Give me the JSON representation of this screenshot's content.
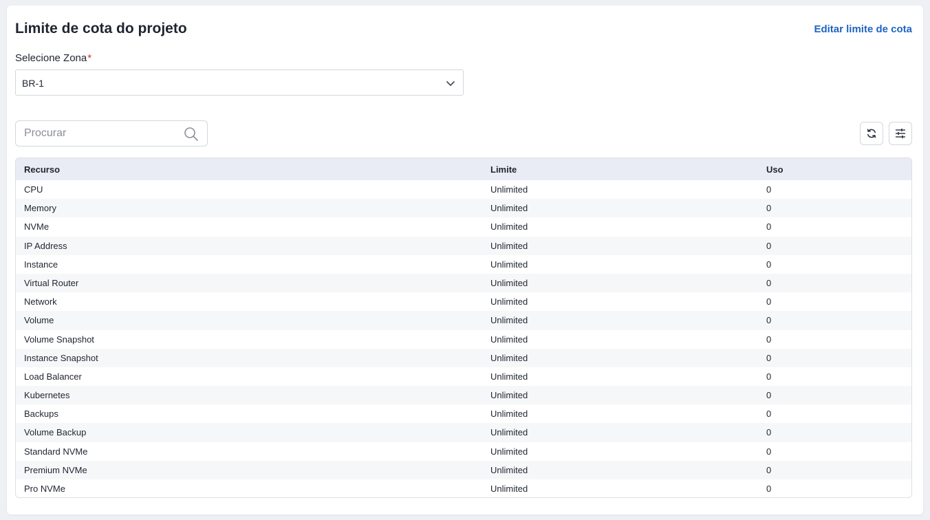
{
  "header": {
    "title": "Limite de cota do projeto",
    "edit_link": "Editar limite de cota"
  },
  "zone": {
    "label": "Selecione Zona",
    "required_mark": "*",
    "selected": "BR-1"
  },
  "search": {
    "placeholder": "Procurar"
  },
  "table": {
    "columns": [
      "Recurso",
      "Limite",
      "Uso"
    ],
    "rows": [
      [
        "CPU",
        "Unlimited",
        "0"
      ],
      [
        "Memory",
        "Unlimited",
        "0"
      ],
      [
        "NVMe",
        "Unlimited",
        "0"
      ],
      [
        "IP Address",
        "Unlimited",
        "0"
      ],
      [
        "Instance",
        "Unlimited",
        "0"
      ],
      [
        "Virtual Router",
        "Unlimited",
        "0"
      ],
      [
        "Network",
        "Unlimited",
        "0"
      ],
      [
        "Volume",
        "Unlimited",
        "0"
      ],
      [
        "Volume Snapshot",
        "Unlimited",
        "0"
      ],
      [
        "Instance Snapshot",
        "Unlimited",
        "0"
      ],
      [
        "Load Balancer",
        "Unlimited",
        "0"
      ],
      [
        "Kubernetes",
        "Unlimited",
        "0"
      ],
      [
        "Backups",
        "Unlimited",
        "0"
      ],
      [
        "Volume Backup",
        "Unlimited",
        "0"
      ],
      [
        "Standard NVMe",
        "Unlimited",
        "0"
      ],
      [
        "Premium NVMe",
        "Unlimited",
        "0"
      ],
      [
        "Pro NVMe",
        "Unlimited",
        "0"
      ]
    ]
  },
  "icons": {
    "dropdown": "chevron-down-icon",
    "search": "search-icon",
    "refresh": "refresh-icon",
    "settings": "sliders-icon"
  },
  "colors": {
    "link": "#1e63c4",
    "required": "#d0342c",
    "table_header_bg": "#e9ecf5"
  }
}
